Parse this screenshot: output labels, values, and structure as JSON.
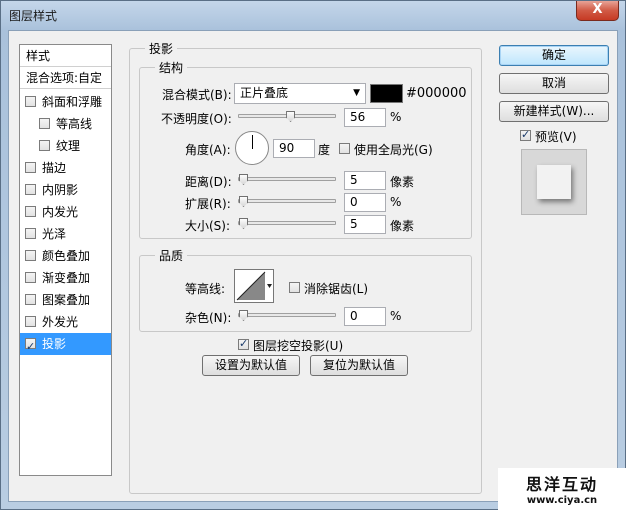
{
  "window": {
    "title": "图层样式",
    "close_label": "X"
  },
  "style_list": {
    "header": "样式",
    "blending": "混合选项:自定",
    "items": [
      {
        "label": "斜面和浮雕",
        "checked": false,
        "indent": false
      },
      {
        "label": "等高线",
        "checked": false,
        "indent": true
      },
      {
        "label": "纹理",
        "checked": false,
        "indent": true
      },
      {
        "label": "描边",
        "checked": false,
        "indent": false
      },
      {
        "label": "内阴影",
        "checked": false,
        "indent": false
      },
      {
        "label": "内发光",
        "checked": false,
        "indent": false
      },
      {
        "label": "光泽",
        "checked": false,
        "indent": false
      },
      {
        "label": "颜色叠加",
        "checked": false,
        "indent": false
      },
      {
        "label": "渐变叠加",
        "checked": false,
        "indent": false
      },
      {
        "label": "图案叠加",
        "checked": false,
        "indent": false
      },
      {
        "label": "外发光",
        "checked": false,
        "indent": false
      },
      {
        "label": "投影",
        "checked": true,
        "indent": false,
        "selected": true
      }
    ]
  },
  "panel": {
    "title": "投影",
    "structure": {
      "title": "结构",
      "blend_mode_label": "混合模式(B):",
      "blend_mode_value": "正片叠底",
      "color_hex": "#000000",
      "opacity_label": "不透明度(O):",
      "opacity_value": "56",
      "opacity_fraction": 0.56,
      "percent": "%",
      "angle_label": "角度(A):",
      "angle_value": "90",
      "degree_unit": "度",
      "global_light_label": "使用全局光(G)",
      "distance_label": "距离(D):",
      "distance_value": "5",
      "spread_label": "扩展(R):",
      "spread_value": "0",
      "size_label": "大小(S):",
      "size_value": "5",
      "pixel_unit": "像素"
    },
    "quality": {
      "title": "品质",
      "contour_label": "等高线:",
      "antialias_label": "消除锯齿(L)",
      "noise_label": "杂色(N):",
      "noise_value": "0",
      "percent": "%"
    },
    "knockout_label": "图层挖空投影(U)",
    "make_default": "设置为默认值",
    "reset_default": "复位为默认值"
  },
  "buttons": {
    "ok": "确定",
    "cancel": "取消",
    "new_style": "新建样式(W)...",
    "preview_label": "预览(V)"
  },
  "watermark": {
    "title": "思洋互动",
    "url": "www.ciya.cn"
  }
}
